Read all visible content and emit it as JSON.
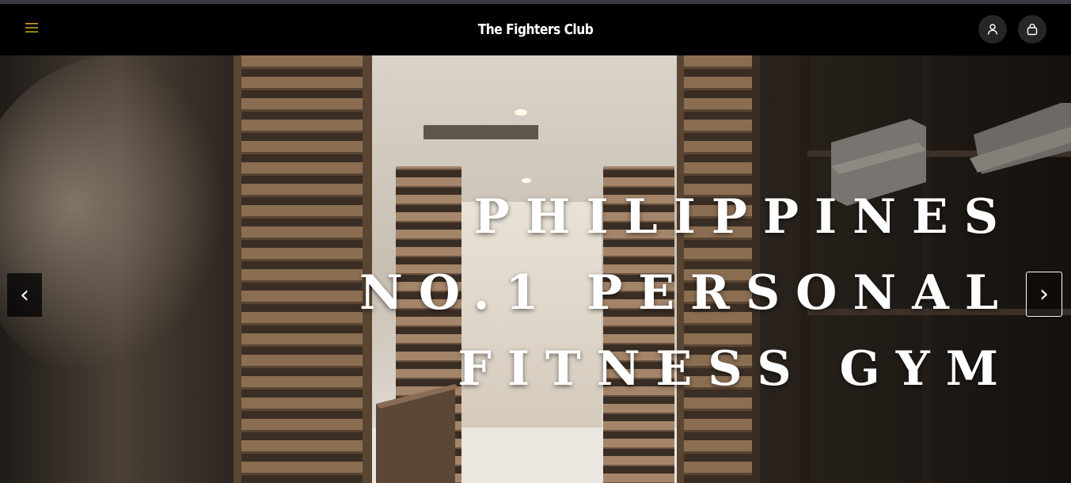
{
  "header": {
    "brand": "The Fighters Club",
    "menu_icon": "hamburger-menu-icon",
    "account_icon": "user-icon",
    "cart_icon": "shopping-bag-icon",
    "accent_color": "#c9a227"
  },
  "hero": {
    "headline_lines": [
      "PHILIPPINES",
      "NO.1 PERSONAL",
      "FITNESS GYM"
    ],
    "prev_label": "‹",
    "next_label": "›"
  }
}
